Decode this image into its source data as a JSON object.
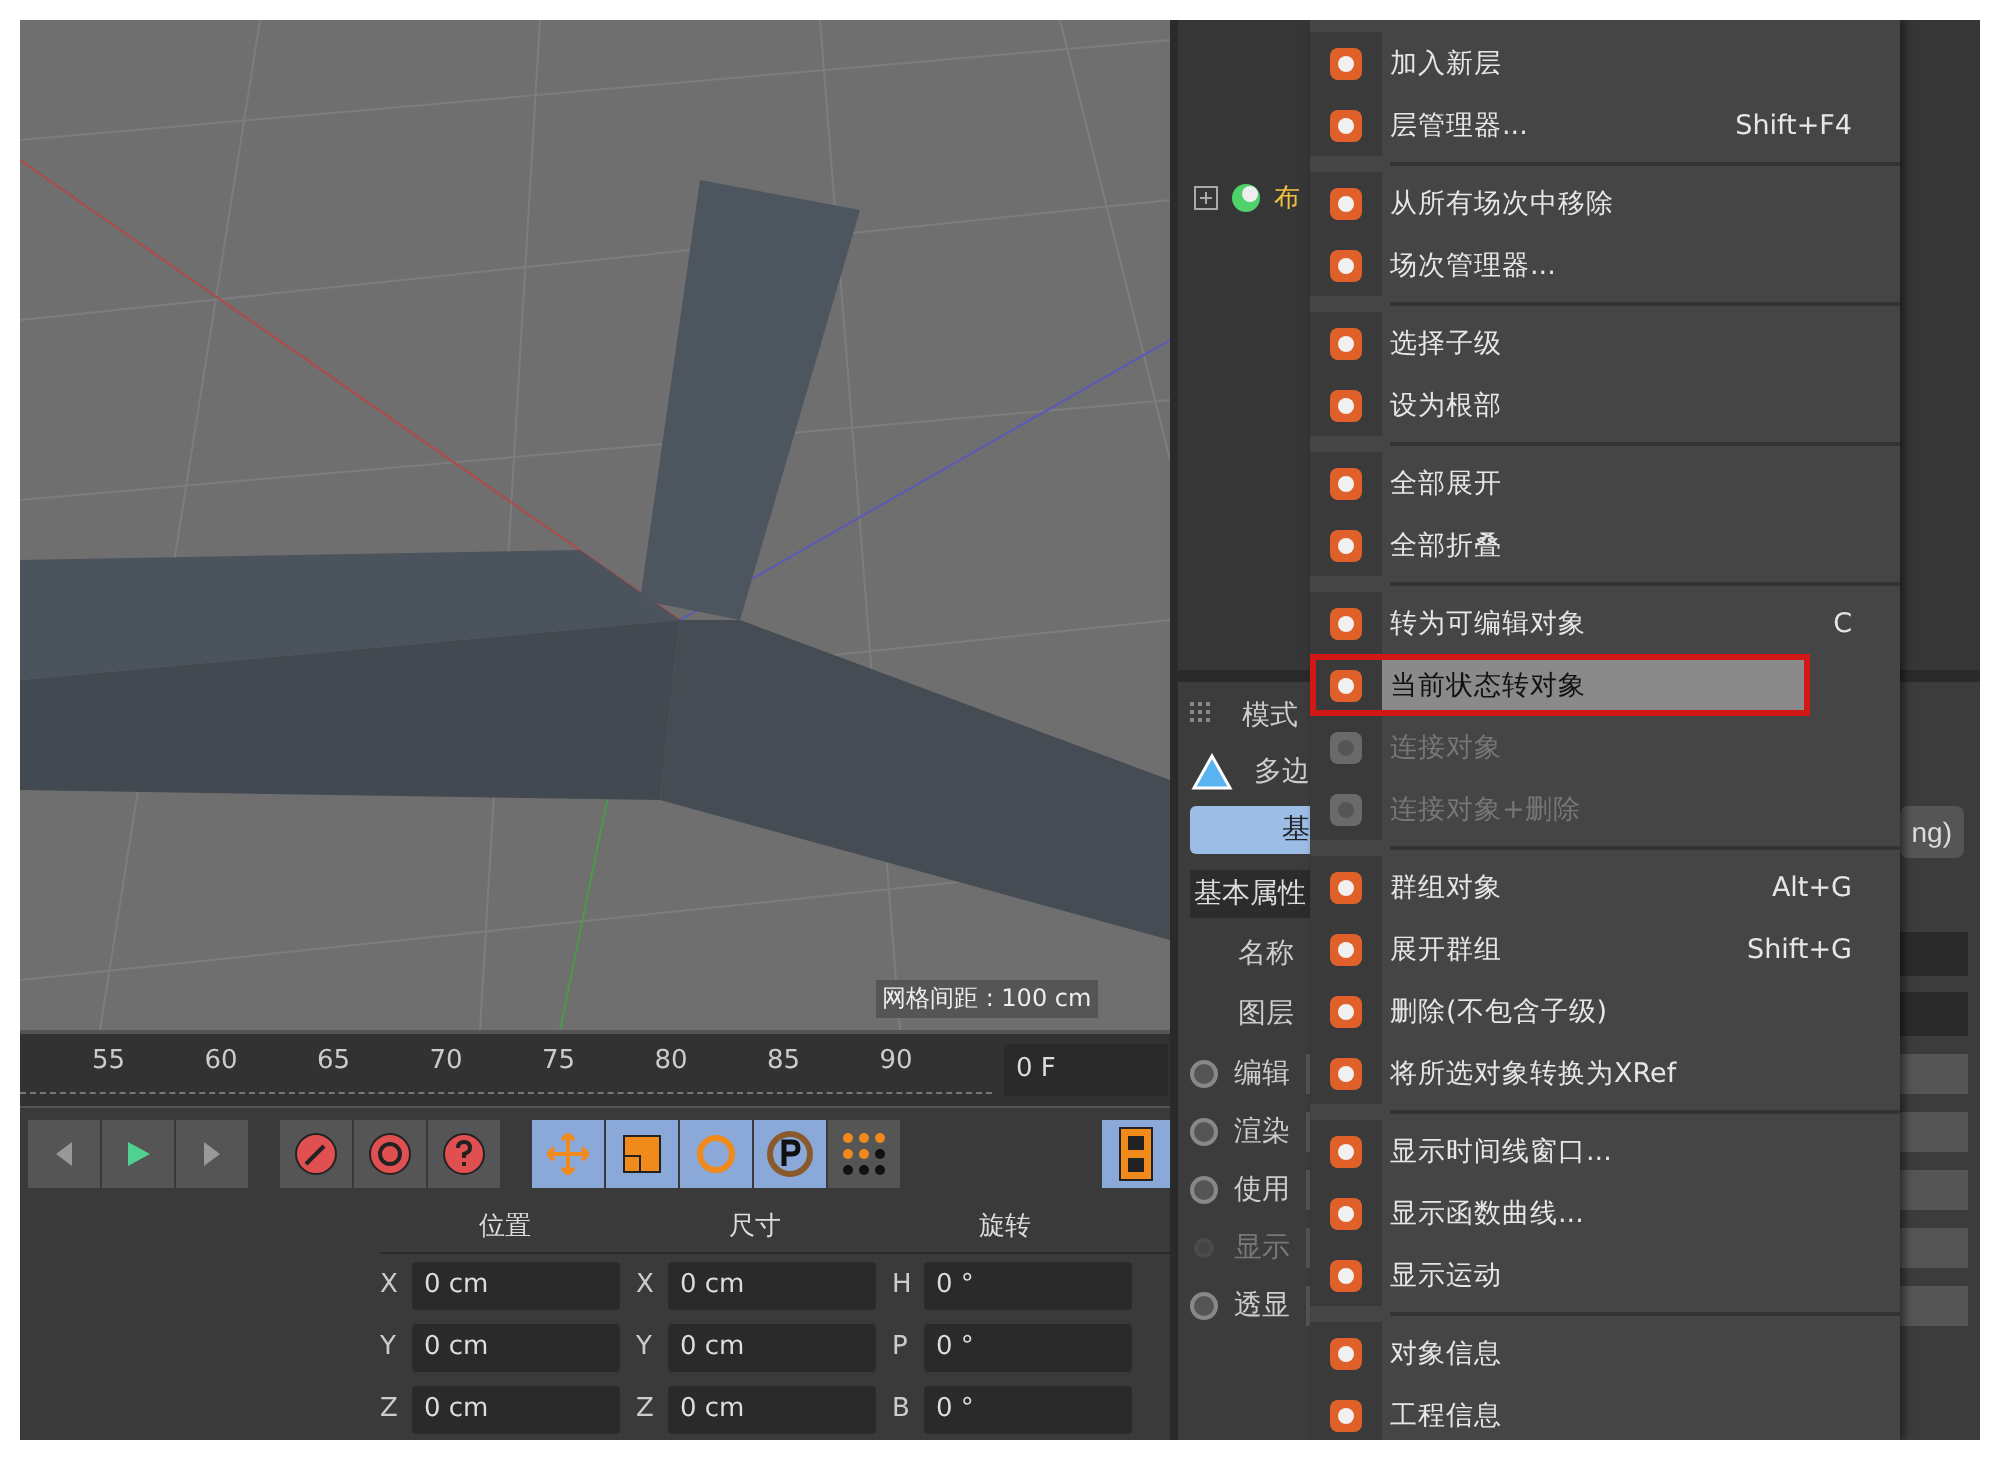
{
  "viewport": {
    "grid_label": "网格间距 : 100 cm"
  },
  "timeline": {
    "ticks": [
      "55",
      "60",
      "65",
      "70",
      "75",
      "80",
      "85",
      "90"
    ],
    "frame_field": "0 F"
  },
  "coordinates": {
    "headers": [
      "位置",
      "尺寸",
      "旋转"
    ],
    "rows": [
      {
        "pos_axis": "X",
        "pos": "0 cm",
        "size_axis": "X",
        "size": "0 cm",
        "rot_axis": "H",
        "rot": "0 °"
      },
      {
        "pos_axis": "Y",
        "pos": "0 cm",
        "size_axis": "Y",
        "size": "0 cm",
        "rot_axis": "P",
        "rot": "0 °"
      },
      {
        "pos_axis": "Z",
        "pos": "0 cm",
        "size_axis": "Z",
        "size": "0 cm",
        "rot_axis": "B",
        "rot": "0 °"
      }
    ]
  },
  "object_manager": {
    "rows": [
      {
        "label": "布"
      }
    ]
  },
  "attributes": {
    "mode_label": "模式",
    "object_label": "多边",
    "tab": "基",
    "right_button": "ng)",
    "section": "基本属性",
    "fields": [
      "名称",
      "图层"
    ],
    "options": [
      {
        "label": "编辑",
        "disabled": false
      },
      {
        "label": "渲染",
        "disabled": false
      },
      {
        "label": "使用",
        "disabled": false
      },
      {
        "label": "显示",
        "disabled": true
      },
      {
        "label": "透显",
        "disabled": false
      }
    ]
  },
  "menu": {
    "groups": [
      [
        {
          "label": "加入新层",
          "disabled": false,
          "selected": false
        },
        {
          "label": "层管理器...",
          "shortcut": "Shift+F4",
          "disabled": false,
          "selected": false
        }
      ],
      [
        {
          "label": "从所有场次中移除",
          "disabled": false,
          "selected": false
        },
        {
          "label": "场次管理器...",
          "disabled": false,
          "selected": false
        }
      ],
      [
        {
          "label": "选择子级",
          "disabled": false,
          "selected": false
        },
        {
          "label": "设为根部",
          "disabled": false,
          "selected": false
        }
      ],
      [
        {
          "label": "全部展开",
          "disabled": false,
          "selected": false
        },
        {
          "label": "全部折叠",
          "disabled": false,
          "selected": false
        }
      ],
      [
        {
          "label": "转为可编辑对象",
          "shortcut": "C",
          "disabled": false,
          "selected": false
        },
        {
          "label": "当前状态转对象",
          "disabled": false,
          "selected": true
        },
        {
          "label": "连接对象",
          "disabled": true,
          "selected": false
        },
        {
          "label": "连接对象+删除",
          "disabled": true,
          "selected": false
        }
      ],
      [
        {
          "label": "群组对象",
          "shortcut": "Alt+G",
          "disabled": false,
          "selected": false
        },
        {
          "label": "展开群组",
          "shortcut": "Shift+G",
          "disabled": false,
          "selected": false
        },
        {
          "label": "删除(不包含子级)",
          "disabled": false,
          "selected": false
        },
        {
          "label": "将所选对象转换为XRef",
          "disabled": false,
          "selected": false
        }
      ],
      [
        {
          "label": "显示时间线窗口...",
          "disabled": false,
          "selected": false
        },
        {
          "label": "显示函数曲线...",
          "disabled": false,
          "selected": false
        },
        {
          "label": "显示运动",
          "disabled": false,
          "selected": false
        }
      ],
      [
        {
          "label": "对象信息",
          "disabled": false,
          "selected": false
        },
        {
          "label": "工程信息",
          "disabled": false,
          "selected": false
        }
      ]
    ]
  }
}
